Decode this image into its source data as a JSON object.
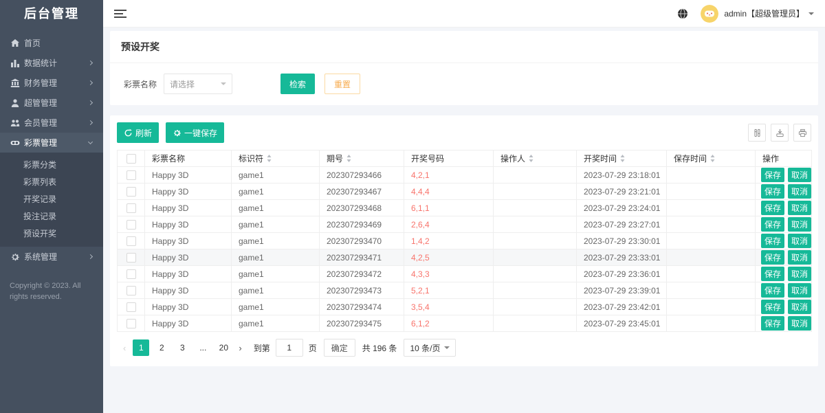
{
  "app": {
    "logo": "后台管理",
    "user": "admin【超级管理员】"
  },
  "sidebar": {
    "items": [
      {
        "label": "首页"
      },
      {
        "label": "数据统计"
      },
      {
        "label": "财务管理"
      },
      {
        "label": "超管管理"
      },
      {
        "label": "会员管理"
      },
      {
        "label": "彩票管理"
      },
      {
        "label": "系统管理"
      }
    ],
    "submenu": [
      "彩票分类",
      "彩票列表",
      "开奖记录",
      "投注记录",
      "预设开奖"
    ],
    "copyright": "Copyright © 2023. All rights reserved."
  },
  "page": {
    "title": "预设开奖",
    "filter": {
      "label": "彩票名称",
      "placeholder": "请选择",
      "search": "检索",
      "reset": "重置"
    },
    "toolbar": {
      "refresh": "刷新",
      "save_all": "一键保存"
    },
    "table": {
      "headers": [
        "",
        "彩票名称",
        "标识符",
        "期号",
        "开奖号码",
        "操作人",
        "开奖时间",
        "保存时间",
        "操作"
      ],
      "row_actions": {
        "save": "保存",
        "cancel": "取消"
      },
      "rows": [
        {
          "name": "Happy 3D",
          "code": "game1",
          "issue": "202307293466",
          "numbers": "4,2,1",
          "operator": "",
          "draw_time": "2023-07-29 23:18:01",
          "save_time": "",
          "highlight": false
        },
        {
          "name": "Happy 3D",
          "code": "game1",
          "issue": "202307293467",
          "numbers": "4,4,4",
          "operator": "",
          "draw_time": "2023-07-29 23:21:01",
          "save_time": "",
          "highlight": false
        },
        {
          "name": "Happy 3D",
          "code": "game1",
          "issue": "202307293468",
          "numbers": "6,1,1",
          "operator": "",
          "draw_time": "2023-07-29 23:24:01",
          "save_time": "",
          "highlight": false
        },
        {
          "name": "Happy 3D",
          "code": "game1",
          "issue": "202307293469",
          "numbers": "2,6,4",
          "operator": "",
          "draw_time": "2023-07-29 23:27:01",
          "save_time": "",
          "highlight": false
        },
        {
          "name": "Happy 3D",
          "code": "game1",
          "issue": "202307293470",
          "numbers": "1,4,2",
          "operator": "",
          "draw_time": "2023-07-29 23:30:01",
          "save_time": "",
          "highlight": false
        },
        {
          "name": "Happy 3D",
          "code": "game1",
          "issue": "202307293471",
          "numbers": "4,2,5",
          "operator": "",
          "draw_time": "2023-07-29 23:33:01",
          "save_time": "",
          "highlight": true
        },
        {
          "name": "Happy 3D",
          "code": "game1",
          "issue": "202307293472",
          "numbers": "4,3,3",
          "operator": "",
          "draw_time": "2023-07-29 23:36:01",
          "save_time": "",
          "highlight": false
        },
        {
          "name": "Happy 3D",
          "code": "game1",
          "issue": "202307293473",
          "numbers": "5,2,1",
          "operator": "",
          "draw_time": "2023-07-29 23:39:01",
          "save_time": "",
          "highlight": false
        },
        {
          "name": "Happy 3D",
          "code": "game1",
          "issue": "202307293474",
          "numbers": "3,5,4",
          "operator": "",
          "draw_time": "2023-07-29 23:42:01",
          "save_time": "",
          "highlight": false
        },
        {
          "name": "Happy 3D",
          "code": "game1",
          "issue": "202307293475",
          "numbers": "6,1,2",
          "operator": "",
          "draw_time": "2023-07-29 23:45:01",
          "save_time": "",
          "highlight": false
        }
      ]
    },
    "pagination": {
      "prev": "‹",
      "next": "›",
      "pages": [
        "1",
        "2",
        "3",
        "...",
        "20"
      ],
      "active": "1",
      "goto_label": "到第",
      "goto_value": "1",
      "page_unit": "页",
      "confirm": "确定",
      "total": "共 196 条",
      "per_page": "10 条/页"
    }
  },
  "colors": {
    "accent": "#16b998",
    "danger": "#f8736b",
    "warning": "#f7ab4e",
    "sidebar": "#45505f"
  }
}
